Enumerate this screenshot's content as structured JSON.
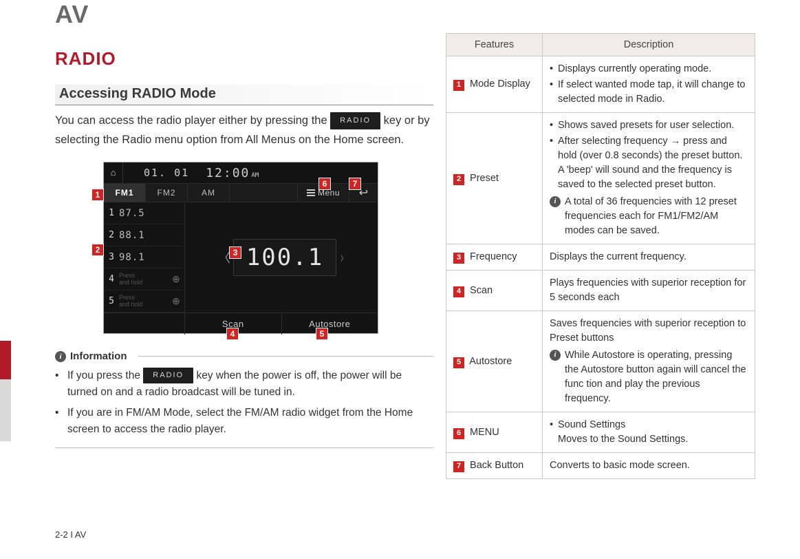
{
  "header": {
    "av": "AV",
    "radio": "RADIO",
    "subtitle": "Accessing RADIO Mode"
  },
  "intro": {
    "line1": "You can access the radio player either by pressing the ",
    "radio_key": "RADIO",
    "line2": " key or by selecting the Radio menu option from All Menus on the Home screen."
  },
  "radio_ui": {
    "date": "01. 01",
    "time": "12:00",
    "ampm": "AM",
    "bands": {
      "fm1": "FM1",
      "fm2": "FM2",
      "am": "AM"
    },
    "menu_label": "Menu",
    "presets": {
      "p1": "87.5",
      "p2": "88.1",
      "p3": "98.1",
      "empty_label_a": "Press",
      "empty_label_b": "and hold"
    },
    "freq": "100.1",
    "scan": "Scan",
    "autostore": "Autostore"
  },
  "callouts": {
    "c1": "1",
    "c2": "2",
    "c3": "3",
    "c4": "4",
    "c5": "5",
    "c6": "6",
    "c7": "7"
  },
  "info": {
    "title": "Information",
    "b1a": "If you press the ",
    "b1b": " key when the power is off, the power will be turned on and a radio broadcast will be tuned in.",
    "b2": "If you are in FM/AM Mode, select the FM/AM radio widget from the Home screen to access the radio player."
  },
  "table": {
    "h_feat": "Features",
    "h_desc": "Description",
    "rows": {
      "mode": {
        "name": "Mode Display",
        "d1": "Displays currently operating mode.",
        "d2": "If select wanted mode tap, it will change to selected mode in Radio."
      },
      "preset": {
        "name": "Preset",
        "d1": "Shows saved presets for user selection.",
        "d2": "After selecting frequency → press and hold (over 0.8 seconds) the preset button. A 'beep' will sound and the frequency is saved to the selected preset button.",
        "info": "A total of 36 frequencies with 12 preset frequencies each for FM1/FM2/AM modes can be saved."
      },
      "freq": {
        "name": "Frequency",
        "d": "Displays the current frequency."
      },
      "scan": {
        "name": "Scan",
        "d": "Plays frequencies with superior reception for 5 seconds each"
      },
      "auto": {
        "name": "Autostore",
        "d": "Saves frequencies with superior reception to Preset buttons",
        "info": "While Autostore is operating, pressing the Autostore button again will cancel the func tion and play the previous frequency."
      },
      "menu": {
        "name": "MENU",
        "d1": "Sound Settings",
        "d2": "Moves to the Sound Settings."
      },
      "back": {
        "name": "Back Button",
        "d": "Converts to basic mode screen."
      }
    }
  },
  "footer": "2-2 I AV"
}
